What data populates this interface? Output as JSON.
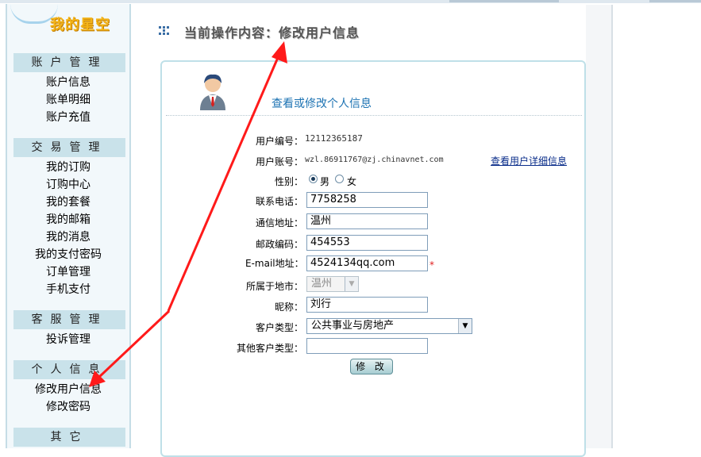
{
  "colors": {
    "accent_blue": "#1d73b3",
    "section_bg": "#c9e2ea",
    "arrow_red": "#ff1a1a",
    "required_star": "#e02020"
  },
  "sidebar": {
    "logo_title": "我的星空",
    "sections": [
      {
        "title": "账户管理",
        "items": [
          "账户信息",
          "账单明细",
          "账户充值"
        ]
      },
      {
        "title": "交易管理",
        "items": [
          "我的订购",
          "订购中心",
          "我的套餐",
          "我的邮箱",
          "我的消息",
          "我的支付密码",
          "订单管理",
          "手机支付"
        ]
      },
      {
        "title": "客服管理",
        "items": [
          "投诉管理"
        ]
      },
      {
        "title": "个人信息",
        "items": [
          "修改用户信息",
          "修改密码"
        ]
      },
      {
        "title": "其它",
        "items": []
      }
    ]
  },
  "header": {
    "breadcrumb": "当前操作内容：修改用户信息"
  },
  "panel": {
    "title": "查看或修改个人信息",
    "avatar_icon": "user-avatar-icon",
    "fields": {
      "user_id_label": "用户编号：",
      "user_id": "12112365187",
      "account_label": "用户账号：",
      "account": "wzl.86911767@zj.chinavnet.com",
      "detail_link": "查看用户详细信息",
      "gender_label": "性别：",
      "gender_male": "男",
      "gender_female": "女",
      "gender_selected": "男",
      "phone_label": "联系电话：",
      "phone": "7758258",
      "address_label": "通信地址：",
      "address": "温州",
      "postcode_label": "邮政编码：",
      "postcode": "454553",
      "email_label": "E-mail地址：",
      "email": "4524134qq.com",
      "email_required": "*",
      "city_label": "所属于地市：",
      "city": "温州",
      "nickname_label": "昵称：",
      "nickname": "刘行",
      "customer_type_label": "客户类型：",
      "customer_type": "公共事业与房地产",
      "other_type_label": "其他客户类型：",
      "other_type": ""
    },
    "submit_label": "修 改"
  }
}
